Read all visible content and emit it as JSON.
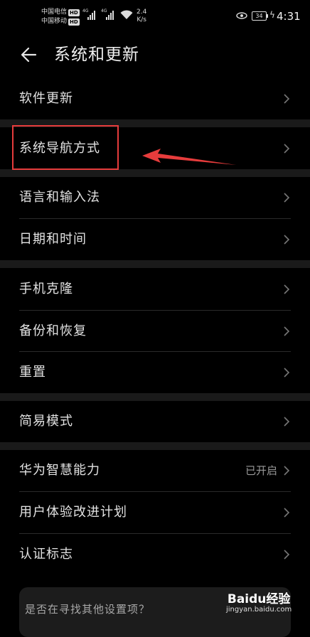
{
  "status": {
    "carrier1": "中国电信",
    "carrier2": "中国移动",
    "hd": "HD",
    "net_gen": "4G",
    "speed_value": "2.4",
    "speed_unit": "K/s",
    "battery": "34",
    "time": "4:31"
  },
  "header": {
    "title": "系统和更新"
  },
  "items": [
    {
      "label": "软件更新"
    },
    {
      "label": "系统导航方式"
    },
    {
      "label": "语言和输入法"
    },
    {
      "label": "日期和时间"
    },
    {
      "label": "手机克隆"
    },
    {
      "label": "备份和恢复"
    },
    {
      "label": "重置"
    },
    {
      "label": "简易模式"
    },
    {
      "label": "华为智慧能力",
      "value": "已开启"
    },
    {
      "label": "用户体验改进计划"
    },
    {
      "label": "认证标志"
    }
  ],
  "suggest": {
    "text": "是否在寻找其他设置项？"
  },
  "watermark": {
    "brand": "Baidu经验",
    "url": "jingyan.baidu.com"
  },
  "annotation": {
    "highlight_color": "#e63c3c",
    "highlighted_item": "系统导航方式"
  }
}
